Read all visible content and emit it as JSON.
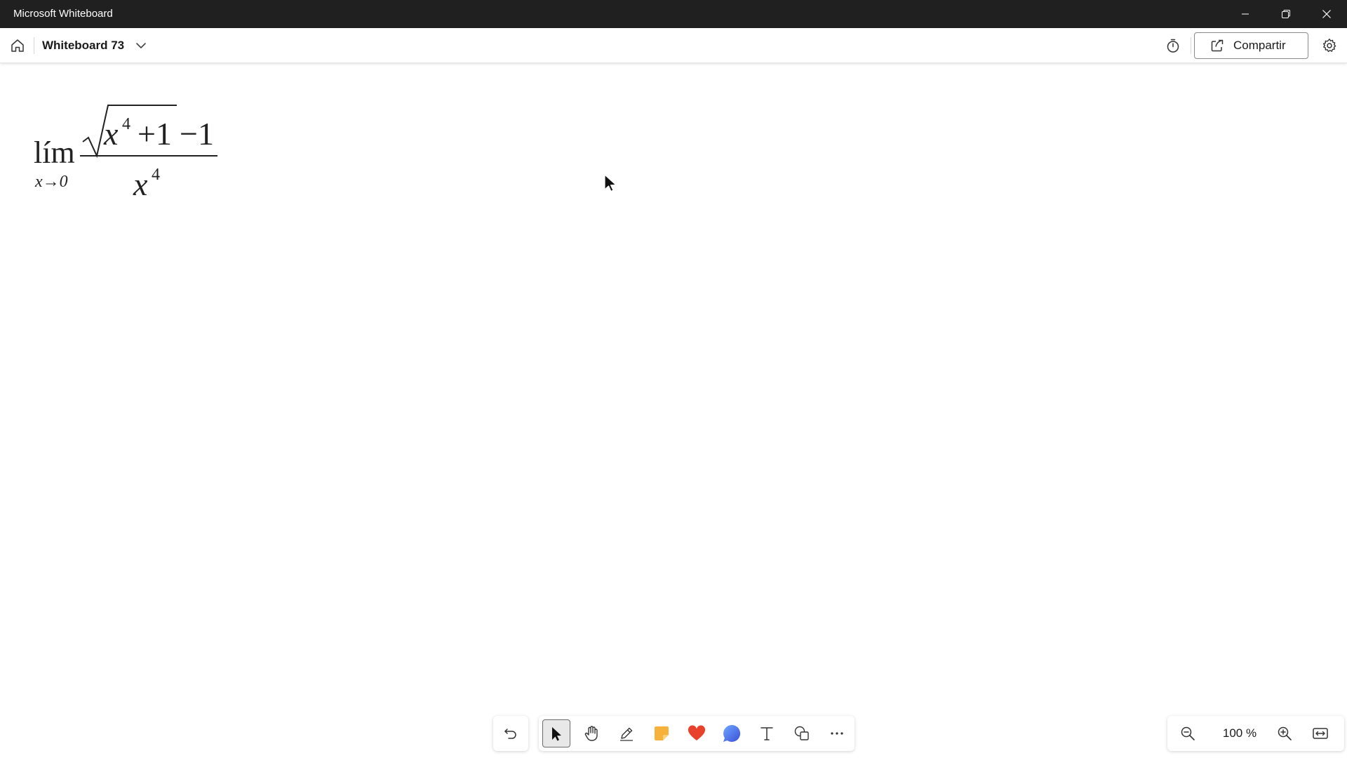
{
  "window": {
    "app_title": "Microsoft Whiteboard",
    "controls": {
      "minimize": "minimize-icon",
      "restore": "restore-icon",
      "close": "close-icon"
    }
  },
  "header": {
    "home_icon": "home-icon",
    "board_title": "Whiteboard 73",
    "board_menu_icon": "chevron-down-icon",
    "timer_icon": "timer-icon",
    "share_label": "Compartir",
    "share_icon": "share-icon",
    "settings_icon": "gear-icon"
  },
  "canvas": {
    "math": {
      "operator": "lím",
      "subscript": "x→0",
      "numerator_radicand": "x",
      "numerator_exp": "4",
      "numerator_rest": "+1",
      "numerator_tail": "−1",
      "denominator": "x",
      "denominator_exp": "4"
    }
  },
  "toolbar": {
    "undo_icon": "undo-icon",
    "tools": [
      {
        "name": "select",
        "icon": "pointer-icon",
        "selected": true
      },
      {
        "name": "pan",
        "icon": "hand-icon",
        "selected": false
      },
      {
        "name": "pen",
        "icon": "pen-icon",
        "selected": false
      },
      {
        "name": "sticky-note",
        "icon": "sticky-note-icon",
        "selected": false
      },
      {
        "name": "reactions",
        "icon": "heart-icon",
        "selected": false
      },
      {
        "name": "comment",
        "icon": "comment-icon",
        "selected": false
      },
      {
        "name": "text",
        "icon": "text-icon",
        "selected": false
      },
      {
        "name": "shapes",
        "icon": "shapes-icon",
        "selected": false
      },
      {
        "name": "more",
        "icon": "more-icon",
        "selected": false
      }
    ]
  },
  "zoom": {
    "level": "100 %",
    "zoom_out_icon": "zoom-out-icon",
    "zoom_in_icon": "zoom-in-icon",
    "fit_icon": "fit-screen-icon"
  },
  "colors": {
    "titlebar_bg": "#202020",
    "sticky_note": "#f7b23b",
    "heart": "#e8412c",
    "comment": "#4f6bed"
  }
}
